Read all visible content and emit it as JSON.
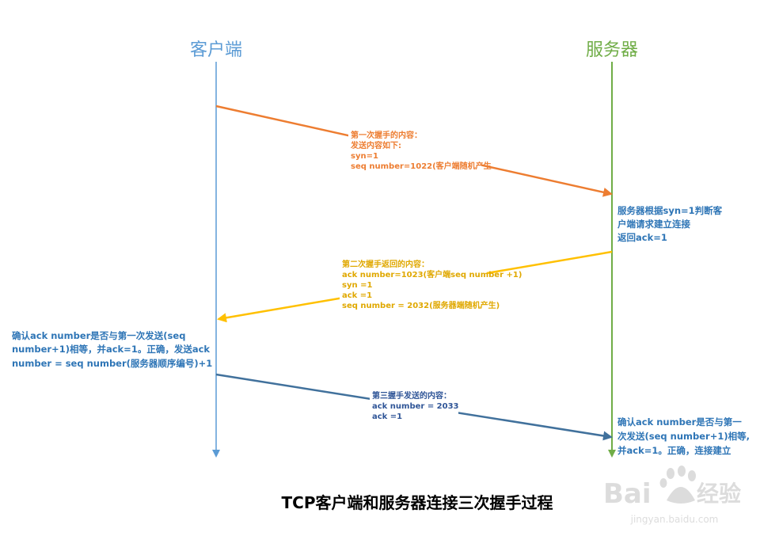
{
  "colors": {
    "client": "#5B9BD5",
    "server": "#70AD47",
    "msg1": "#ED7D31",
    "msg2": "#FFC000",
    "msg3": "#41719C",
    "client_note": "#2E75B6",
    "server_note": "#2E75B6",
    "caption": "#000000",
    "watermark": "#D9D9D9"
  },
  "actors": {
    "client": "客户端",
    "server": "服务器"
  },
  "messages": {
    "first": [
      "第一次握手的内容：",
      "发送内容如下:",
      "syn=1",
      "seq number=1022(客户端随机产生"
    ],
    "second": [
      "第二次握手返回的内容：",
      "ack number=1023(客户端seq number +1)",
      "syn =1",
      "ack =1",
      "seq number = 2032(服务器端随机产生)"
    ],
    "third": [
      "第三握手发送的内容：",
      "ack number = 2033",
      "ack =1"
    ]
  },
  "notes": {
    "server_1": [
      "服务器根据syn=1判断客",
      "户端请求建立连接",
      "返回ack=1"
    ],
    "client_1": [
      "确认ack number是否与第一次发送(seq",
      "number+1)相等，并ack=1。正确，发送ack",
      "number = seq number(服务器顺序编号)+1"
    ],
    "server_2": [
      "确认ack number是否与第一",
      "次发送(seq number+1)相等,",
      "并ack=1。正确，连接建立"
    ]
  },
  "caption": "TCP客户端和服务器连接三次握手过程",
  "watermark": {
    "brand_left": "Bai",
    "brand_right": "经验",
    "url": "jingyan.baidu.com"
  }
}
